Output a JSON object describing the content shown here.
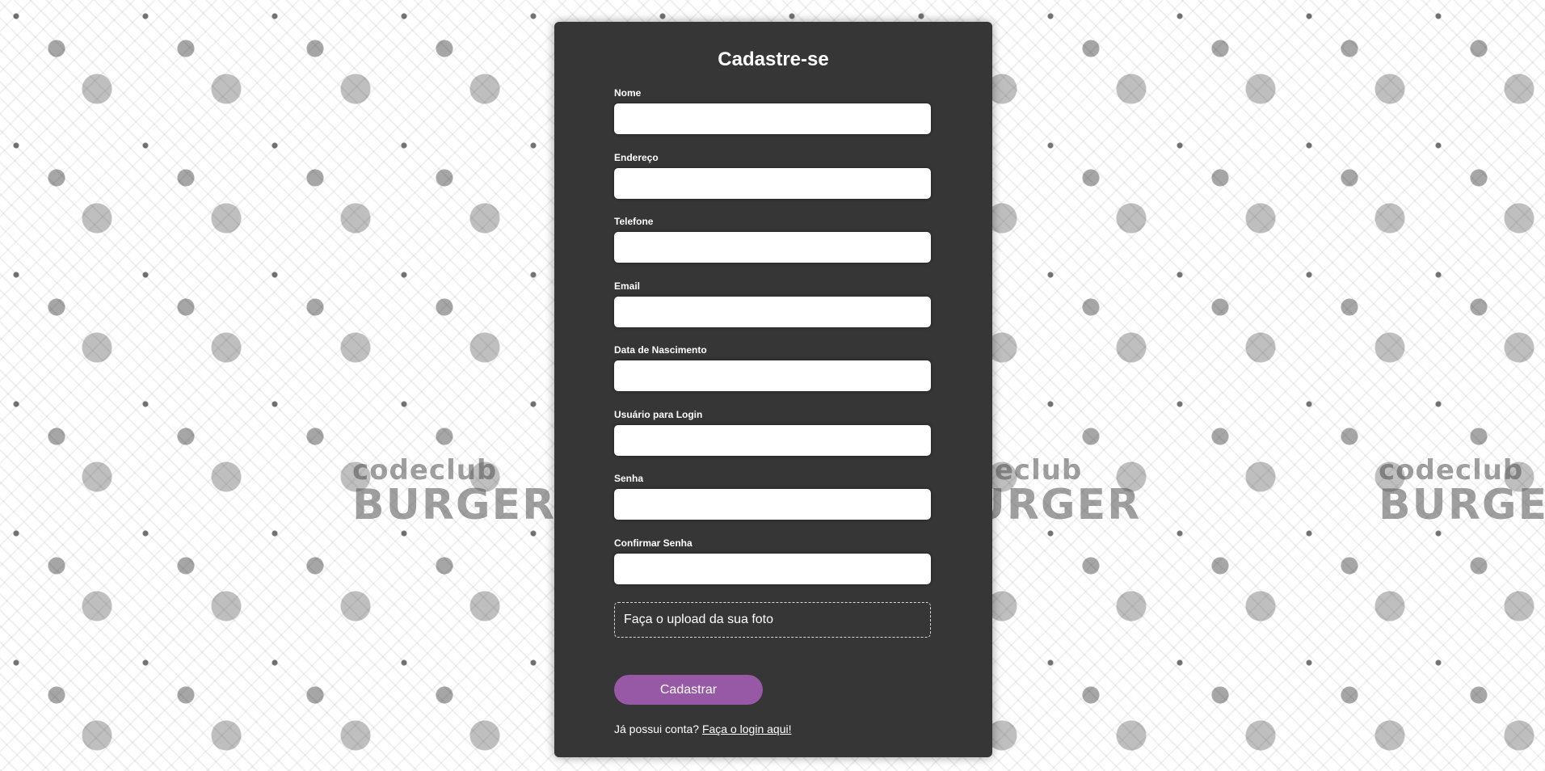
{
  "background": {
    "brand_top": "codeclub",
    "brand_bottom": "BURGER"
  },
  "form": {
    "title": "Cadastre-se",
    "fields": [
      {
        "label": "Nome",
        "value": ""
      },
      {
        "label": "Endereço",
        "value": ""
      },
      {
        "label": "Telefone",
        "value": ""
      },
      {
        "label": "Email",
        "value": ""
      },
      {
        "label": "Data de Nascimento",
        "value": ""
      },
      {
        "label": "Usuário para Login",
        "value": ""
      },
      {
        "label": "Senha",
        "value": ""
      },
      {
        "label": "Confirmar Senha",
        "value": ""
      }
    ],
    "upload_label": "Faça o upload da sua foto",
    "submit_label": "Cadastrar",
    "login_prompt": "Já possui conta?",
    "login_link": "Faça o login aqui!"
  },
  "colors": {
    "card_background": "#363636",
    "button_accent": "#9758a6",
    "text": "#ffffff"
  }
}
